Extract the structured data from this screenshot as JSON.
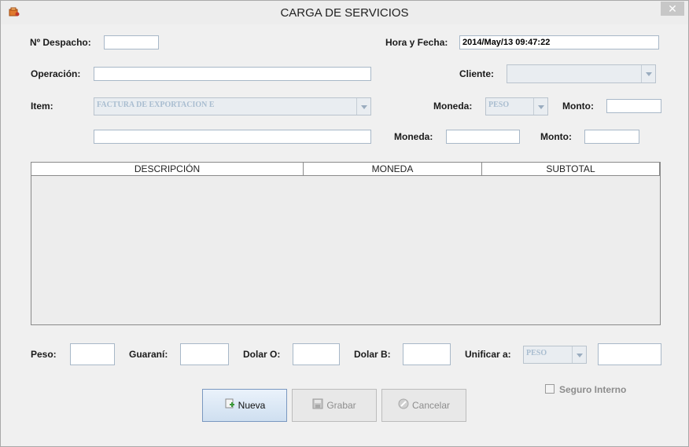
{
  "window": {
    "title": "CARGA DE SERVICIOS",
    "close_label": "✕"
  },
  "form": {
    "despacho_label": "Nº Despacho:",
    "despacho_value": "",
    "hora_fecha_label": "Hora y Fecha:",
    "hora_fecha_value": "2014/May/13 09:47:22",
    "operacion_label": "Operación:",
    "operacion_value": "",
    "cliente_label": "Cliente:",
    "cliente_value": "",
    "item_label": "Item:",
    "item_value": "FACTURA DE EXPORTACION E",
    "moneda1_label": "Moneda:",
    "moneda1_value": "PESO",
    "monto1_label": "Monto:",
    "monto1_value": "",
    "extra_value": "",
    "moneda2_label": "Moneda:",
    "moneda2_value": "",
    "monto2_label": "Monto:",
    "monto2_value": ""
  },
  "table": {
    "columns": [
      "DESCRIPCIÓN",
      "MONEDA",
      "SUBTOTAL"
    ],
    "rows": []
  },
  "totals": {
    "peso_label": "Peso:",
    "peso_value": "",
    "guarani_label": "Guaraní:",
    "guarani_value": "",
    "dolar_o_label": "Dolar O:",
    "dolar_o_value": "",
    "dolar_b_label": "Dolar B:",
    "dolar_b_value": "",
    "unificar_label": "Unificar a:",
    "unificar_value": "PESO",
    "unificar_amount": ""
  },
  "seguro": {
    "label": "Seguro Interno",
    "checked": false
  },
  "buttons": {
    "nueva": "Nueva",
    "grabar": "Grabar",
    "cancelar": "Cancelar"
  },
  "icons": {
    "app": "app-icon",
    "nueva": "add-document-icon",
    "grabar": "save-icon",
    "cancelar": "cancel-icon"
  }
}
